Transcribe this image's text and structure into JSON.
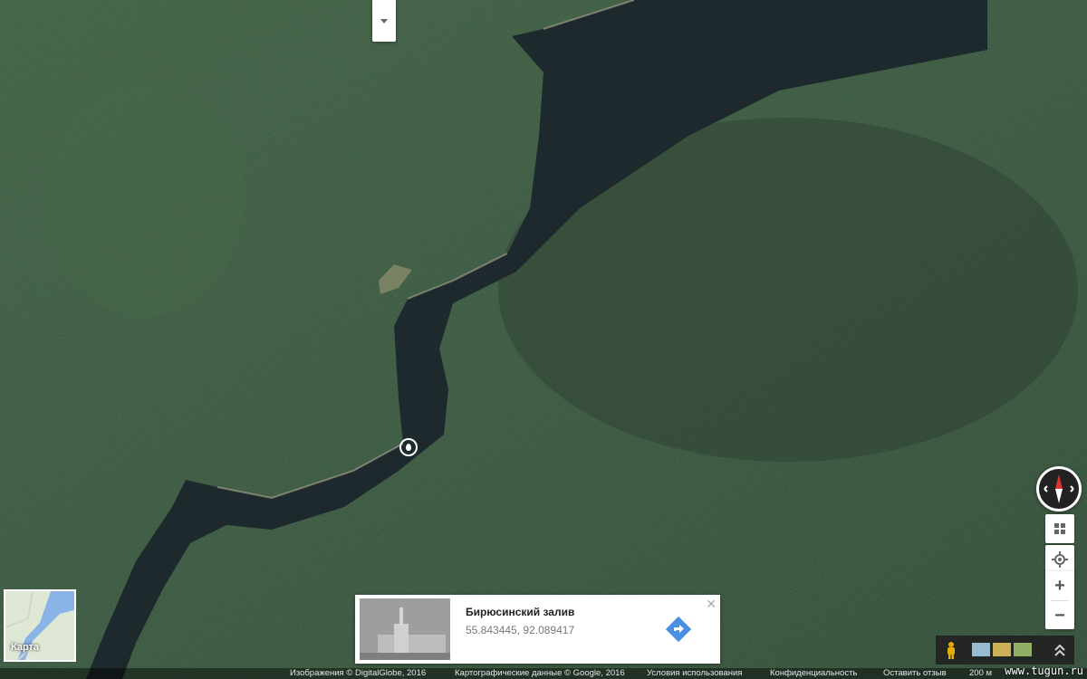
{
  "minimap": {
    "label": "Карта"
  },
  "place": {
    "title": "Бирюсинский залив",
    "coords": "55.843445, 92.089417",
    "close_icon": "close-icon",
    "directions_icon": "directions-icon"
  },
  "footer": {
    "imagery": "Изображения © DigitalGlobe, 2016",
    "mapdata": "Картографические данные © Google, 2016",
    "terms": "Условия использования",
    "privacy": "Конфиденциальность",
    "feedback": "Оставить отзыв",
    "scale": "200 м"
  },
  "watermark": "www.tugun.ru",
  "colors": {
    "forest": "#2f4a31",
    "water": "#1f2a2e",
    "accent": "#4a90e2"
  }
}
